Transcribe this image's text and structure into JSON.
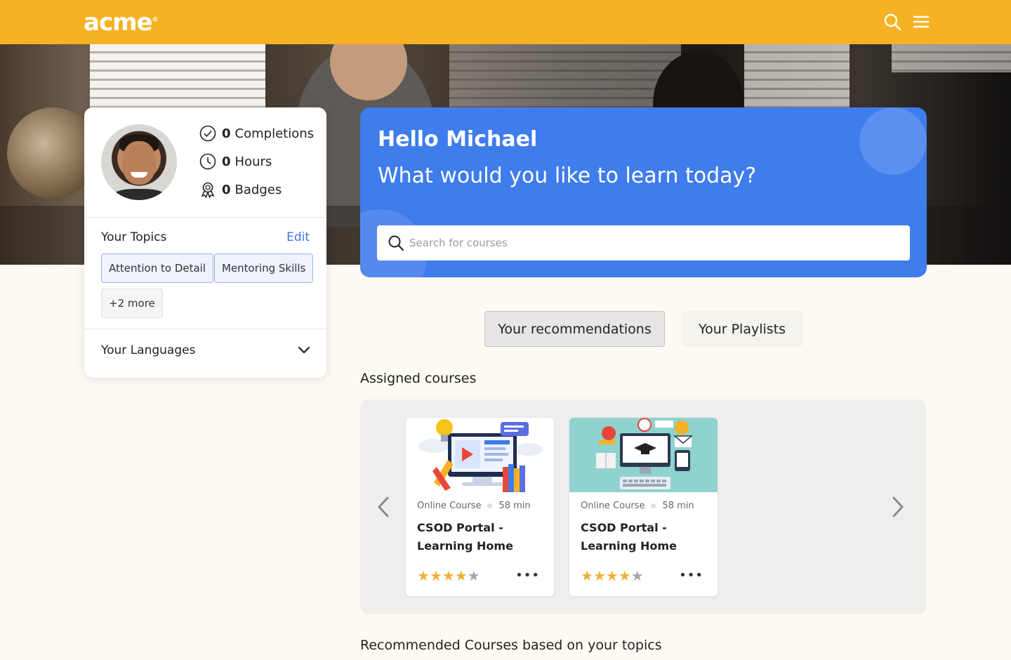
{
  "header": {
    "logo": "acme",
    "logo_mark": "®",
    "search_icon": "search-icon",
    "menu_icon": "menu-icon",
    "brand_color": "#f6b222"
  },
  "profile": {
    "stats": [
      {
        "value": "0",
        "label": "Completions",
        "icon": "check-circle-icon"
      },
      {
        "value": "0",
        "label": "Hours",
        "icon": "clock-icon"
      },
      {
        "value": "0",
        "label": "Badges",
        "icon": "badge-icon"
      }
    ],
    "topics_title": "Your Topics",
    "edit_label": "Edit",
    "topics": [
      "Attention to Detail",
      "Mentoring Skills"
    ],
    "more_topics": "+2 more",
    "languages_label": "Your Languages"
  },
  "welcome": {
    "greeting": "Hello Michael",
    "prompt": "What would you like to learn today?",
    "search_placeholder": "Search for courses",
    "accent": "#3f7cec"
  },
  "tabs": [
    {
      "label": "Your recommendations",
      "active": true
    },
    {
      "label": "Your Playlists",
      "active": false
    }
  ],
  "assigned": {
    "title": "Assigned courses",
    "courses": [
      {
        "type": "Online Course",
        "duration": "58 min",
        "title": "CSOD Portal - Learning Home",
        "rating": 4
      },
      {
        "type": "Online Course",
        "duration": "58 min",
        "title": "CSOD Portal - Learning Home",
        "rating": 4
      }
    ]
  },
  "recommended": {
    "title": "Recommended Courses based on your topics"
  },
  "colors": {
    "star_filled": "#f2b134",
    "star_empty": "#a5a5a5"
  }
}
